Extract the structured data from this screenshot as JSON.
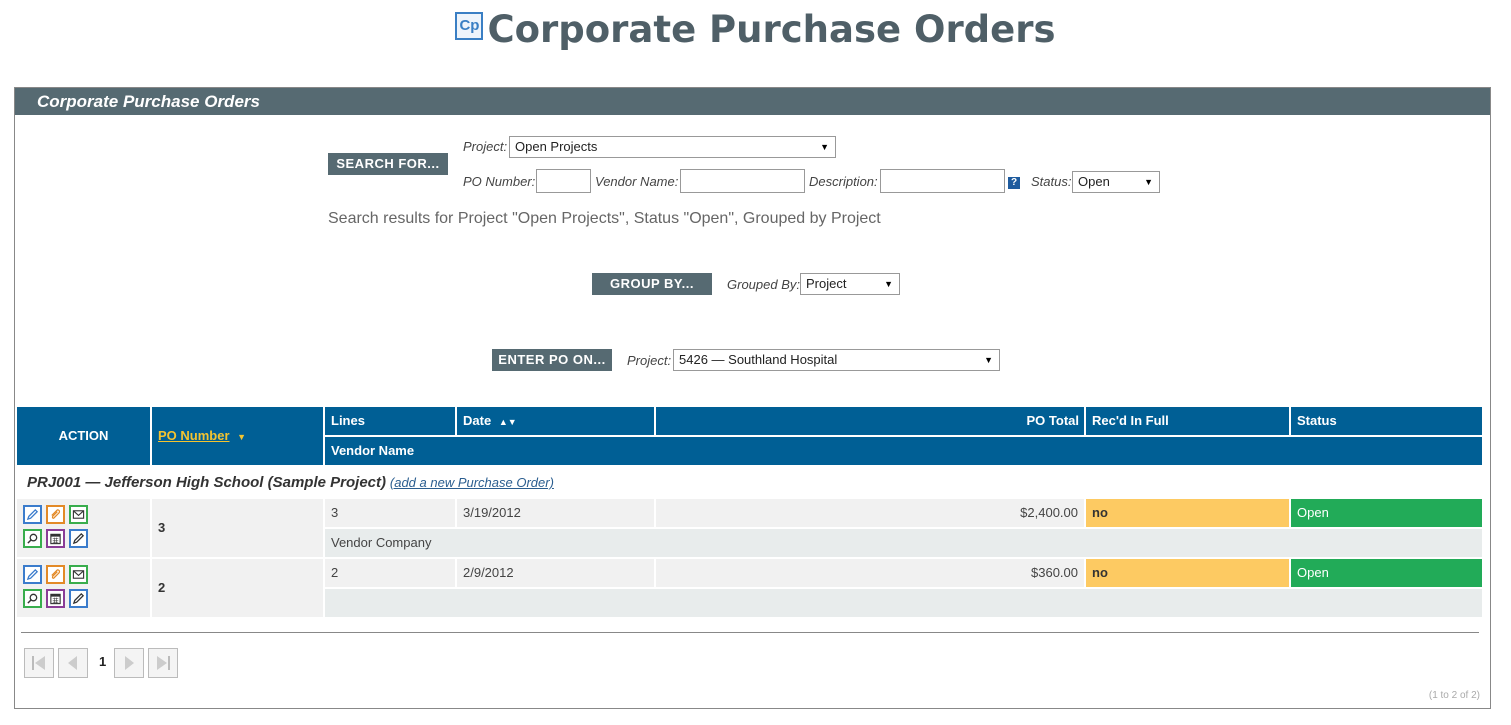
{
  "header": {
    "logo_text": "Cp",
    "title": "Corporate Purchase Orders"
  },
  "panel": {
    "title": "Corporate Purchase Orders"
  },
  "search": {
    "button_label": "SEARCH FOR...",
    "project_label": "Project:",
    "project_value": "Open Projects",
    "po_number_label": "PO Number:",
    "vendor_name_label": "Vendor Name:",
    "description_label": "Description:",
    "help_icon_text": "?",
    "status_label": "Status:",
    "status_value": "Open",
    "results_text": "Search results for Project \"Open Projects\", Status \"Open\", Grouped by Project"
  },
  "group_by": {
    "button_label": "GROUP BY...",
    "label": "Grouped By:",
    "value": "Project"
  },
  "enter_po": {
    "button_label": "ENTER PO ON...",
    "label": "Project:",
    "value": "5426 — Southland Hospital"
  },
  "table": {
    "headers": {
      "action": "ACTION",
      "po_number": "PO Number",
      "lines": "Lines",
      "date": "Date",
      "po_total": "PO Total",
      "recd_in_full": "Rec'd In Full",
      "status": "Status",
      "vendor_name": "Vendor Name"
    },
    "sort_icons": {
      "po_number": "sort-desc-icon",
      "date": "sort-both-icon"
    },
    "group": {
      "title": "PRJ001 — Jefferson High School (Sample Project)",
      "add_link": "(add a new Purchase Order)"
    },
    "rows": [
      {
        "po_number": "3",
        "lines": "3",
        "date": "3/19/2012",
        "po_total": "$2,400.00",
        "recd_in_full": "no",
        "status": "Open",
        "vendor_name": "Vendor Company"
      },
      {
        "po_number": "2",
        "lines": "2",
        "date": "2/9/2012",
        "po_total": "$360.00",
        "recd_in_full": "no",
        "status": "Open",
        "vendor_name": ""
      }
    ],
    "action_icons": [
      "edit-icon",
      "attachment-icon",
      "email-icon",
      "view-icon",
      "calendar-icon",
      "edit-alt-icon"
    ]
  },
  "pagination": {
    "current_page": "1",
    "count_text": "(1 to 2 of 2)"
  },
  "colors": {
    "panel_header": "#566a72",
    "table_header": "#005f95",
    "sort_link": "#f4c430",
    "recd_no": "#fdca62",
    "status_open": "#22ab58"
  }
}
